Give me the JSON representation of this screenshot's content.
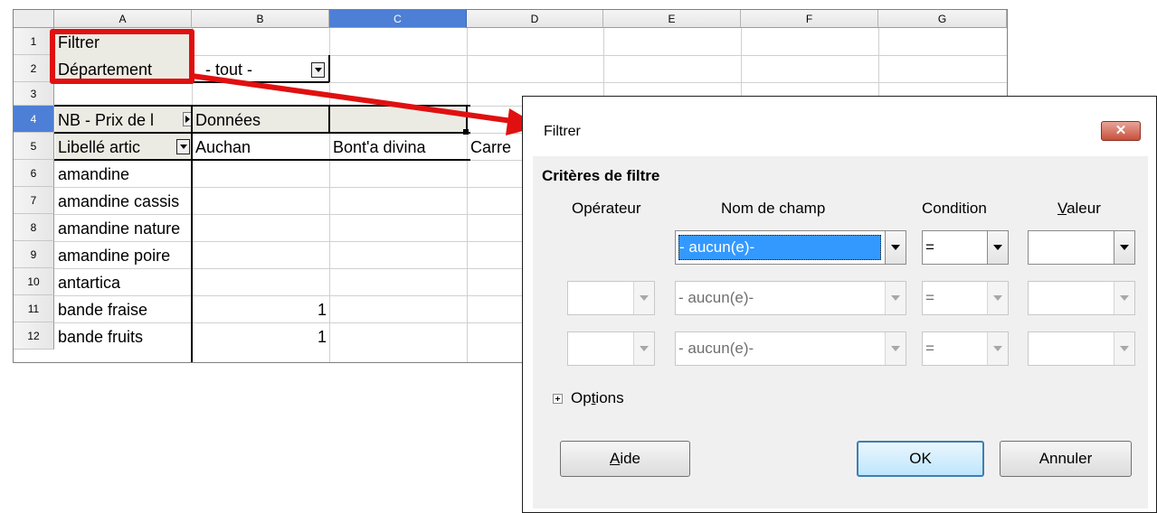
{
  "sheet": {
    "columns": [
      "A",
      "B",
      "C",
      "D",
      "E",
      "F",
      "G"
    ],
    "rows": [
      "1",
      "2",
      "3",
      "4",
      "5",
      "6",
      "7",
      "8",
      "9",
      "10",
      "11",
      "12"
    ],
    "cells": {
      "a1": "Filtrer",
      "a2": "Département",
      "b2": "- tout -",
      "a4": "NB - Prix de l",
      "b4": "Données",
      "a5": "Libellé artic",
      "b5": "Auchan",
      "c5": "Bont'a divina",
      "d5": "Carre",
      "a6": "amandine",
      "a7": "amandine cassis",
      "a8": "amandine nature",
      "a9": "amandine poire",
      "a10": "antartica",
      "a11": "bande fraise",
      "b11": "1",
      "a12": "bande fruits",
      "b12": "1"
    }
  },
  "dialog": {
    "title": "Filtrer",
    "close_label": "✕",
    "section": "Critères de filtre",
    "headers": {
      "operator": "Opérateur",
      "field": "Nom de champ",
      "condition": "Condition",
      "value_prefix": "V",
      "value_rest": "aleur"
    },
    "rows": [
      {
        "operator": "",
        "field": "- aucun(e)-",
        "condition": "=",
        "value": ""
      },
      {
        "operator": "",
        "field": "- aucun(e)-",
        "condition": "=",
        "value": ""
      },
      {
        "operator": "",
        "field": "- aucun(e)-",
        "condition": "=",
        "value": ""
      }
    ],
    "options_pre": "Op",
    "options_key": "t",
    "options_post": "ions",
    "help_key": "A",
    "help_rest": "ide",
    "ok": "OK",
    "cancel": "Annuler"
  },
  "colors": {
    "annotation": "#e01010",
    "selection": "#3399ff",
    "close": "#c74f3c"
  }
}
